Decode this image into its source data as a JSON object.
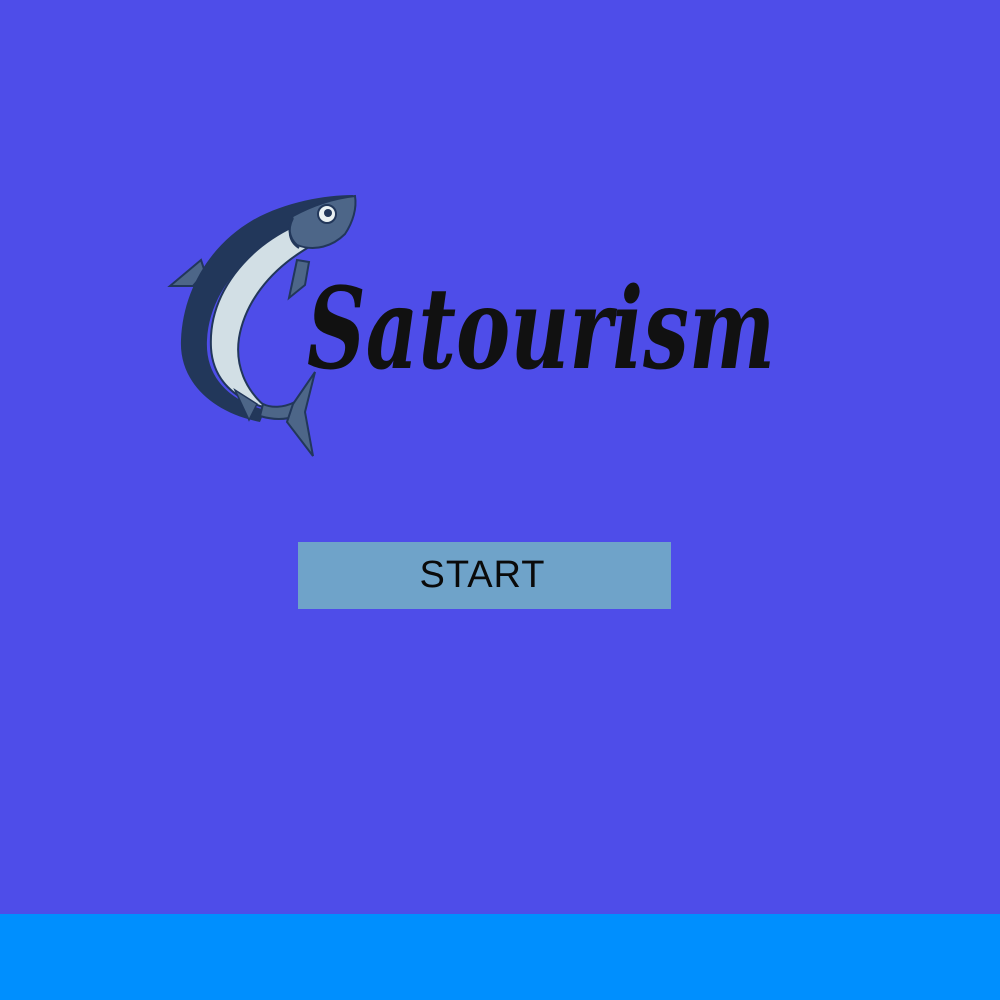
{
  "app": {
    "background_color": "#4e4de9",
    "bottom_bar_color": "#008ffe"
  },
  "logo": {
    "text": "Satourism",
    "icon": "fish-icon",
    "text_color": "#111111",
    "fish_colors": {
      "dark": "#22375a",
      "mid": "#4d6688",
      "light": "#d2dfe5",
      "belly": "#eaf1f3"
    }
  },
  "start_button": {
    "label": "START",
    "background_color": "#6fa3c9"
  }
}
